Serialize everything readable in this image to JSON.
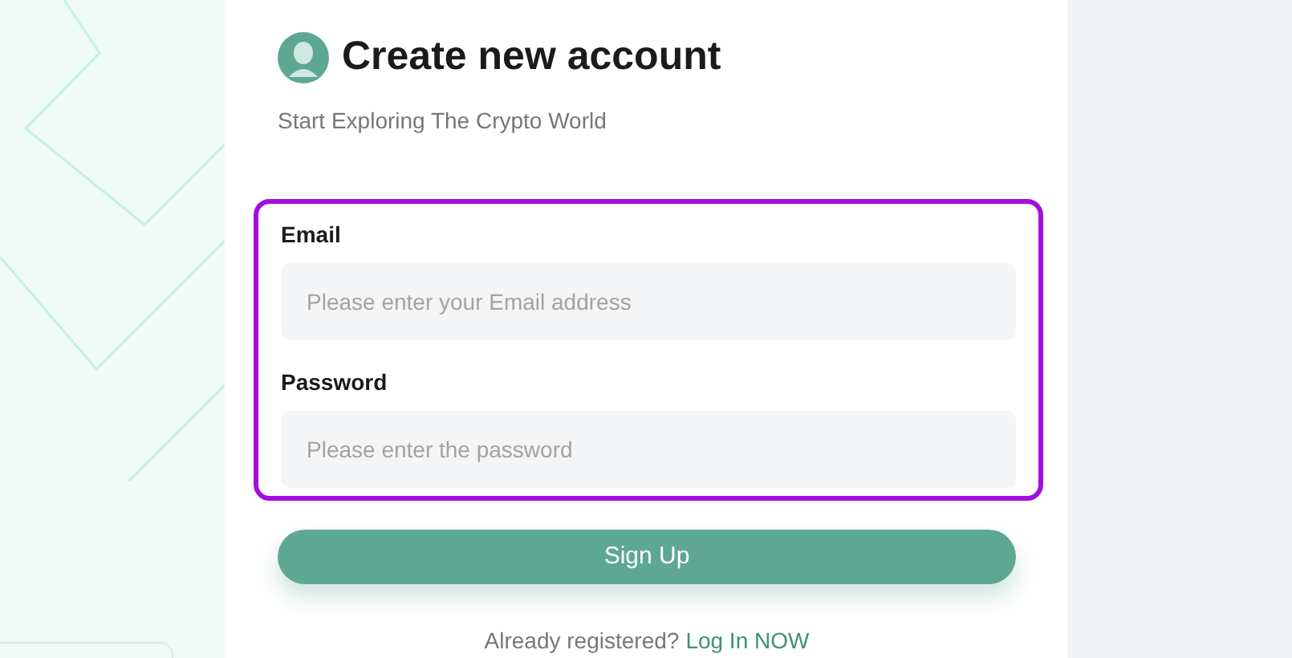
{
  "header": {
    "title": "Create new account",
    "subtitle": "Start Exploring The Crypto World"
  },
  "form": {
    "highlighted": true,
    "fields": [
      {
        "label": "Email",
        "placeholder": "Please enter your Email address"
      },
      {
        "label": "Password",
        "placeholder": "Please enter the password"
      }
    ]
  },
  "submit": {
    "label": "Sign Up"
  },
  "footer": {
    "prompt": "Already registered?",
    "link": "Log In NOW"
  }
}
